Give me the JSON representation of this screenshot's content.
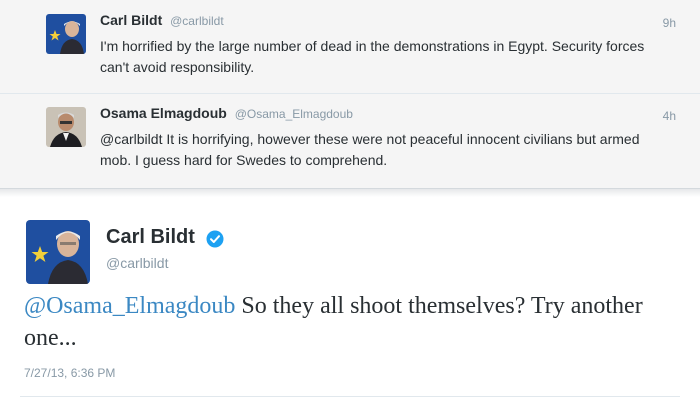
{
  "replies": [
    {
      "name": "Carl Bildt",
      "handle": "@carlbildt",
      "time": "9h",
      "text": "I'm horrified by the large number of dead in the demonstrations in Egypt. Security forces can't avoid responsibility."
    },
    {
      "name": "Osama Elmagdoub",
      "handle": "@Osama_Elmagdoub",
      "time": "4h",
      "text": "@carlbildt It is horrifying, however these were not peaceful innocent civilians but armed mob. I guess hard for Swedes to comprehend."
    }
  ],
  "main": {
    "name": "Carl Bildt",
    "handle": "@carlbildt",
    "verified_icon": "verified-badge-icon",
    "mention": "@Osama_Elmagdoub",
    "text_rest": " So they all shoot themselves? Try another one...",
    "date": "7/27/13, 6:36 PM"
  },
  "colors": {
    "mention": "#3b88c3",
    "verified": "#1da1f2",
    "muted": "#8899a6",
    "gray_bg": "#f5f5f5"
  }
}
